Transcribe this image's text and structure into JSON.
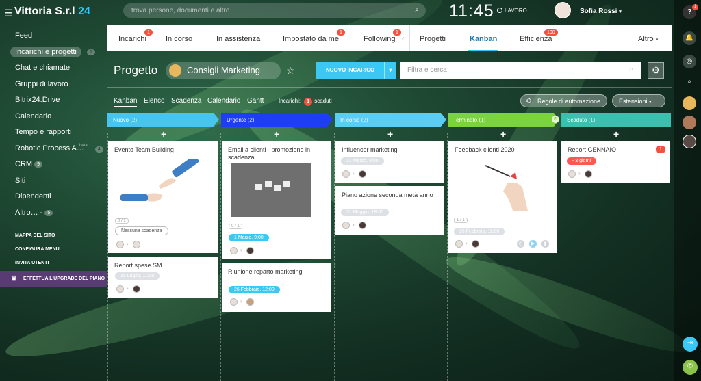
{
  "header": {
    "logo_name": "Vittoria S.r.l",
    "logo_num": "24",
    "search_placeholder": "trova persone, documenti e altro",
    "clock": "11:45",
    "work_status": "LAVORO",
    "user_name": "Sofia Rossi"
  },
  "sidebar": {
    "items": [
      {
        "label": "Feed",
        "badge": ""
      },
      {
        "label": "Incarichi e progetti",
        "badge": "1"
      },
      {
        "label": "Chat e chiamate",
        "badge": ""
      },
      {
        "label": "Gruppi di lavoro",
        "badge": ""
      },
      {
        "label": "Bitrix24.Drive",
        "badge": ""
      },
      {
        "label": "Calendario",
        "badge": ""
      },
      {
        "label": "Tempo e rapporti",
        "badge": ""
      },
      {
        "label": "Robotic Process A…",
        "badge": "4",
        "tag": "beta"
      },
      {
        "label": "CRM",
        "badge": "9"
      },
      {
        "label": "Siti",
        "badge": ""
      },
      {
        "label": "Dipendenti",
        "badge": ""
      },
      {
        "label": "Altro… -",
        "badge": "5"
      }
    ],
    "links": [
      "MAPPA DEL SITO",
      "CONFIGURA MENU",
      "INVITA UTENTI"
    ],
    "upgrade": "EFFETTUA L'UPGRADE DEL PIANO"
  },
  "tabs": [
    {
      "label": "Incarichi",
      "badge": "1"
    },
    {
      "label": "In corso",
      "badge": ""
    },
    {
      "label": "In assistenza",
      "badge": ""
    },
    {
      "label": "Impostato da me",
      "badge": "1"
    },
    {
      "label": "Following",
      "badge": "1"
    },
    {
      "label": "Progetti",
      "badge": ""
    },
    {
      "label": "Kanban",
      "badge": ""
    },
    {
      "label": "Efficienza",
      "badge": "100"
    },
    {
      "label": "Altro",
      "badge": ""
    }
  ],
  "project": {
    "label": "Progetto",
    "name": "Consigli Marketing",
    "new_button": "NUOVO INCARICO",
    "filter_placeholder": "Filtra e cerca"
  },
  "views": [
    "Kanban",
    "Elenco",
    "Scadenza",
    "Calendario",
    "Gantt"
  ],
  "overdue": {
    "prefix": "Incarichi:",
    "count": "1",
    "suffix": "scaduti"
  },
  "automation_button": "Regole di automazione",
  "extensions_button": "Estensioni",
  "columns": [
    {
      "name": "Nuovo",
      "count": "(2)",
      "color": "#47c5ef"
    },
    {
      "name": "Urgente",
      "count": "(2)",
      "color": "#1d3ef5"
    },
    {
      "name": "In corso",
      "count": "(2)",
      "color": "#5ccdf2"
    },
    {
      "name": "Terminato",
      "count": "(1)",
      "color": "#7bd43e"
    },
    {
      "name": "Scaduto",
      "count": "(1)",
      "color": "#3cbfae"
    }
  ],
  "cards": {
    "c1": {
      "title": "Evento Team Building",
      "checklist": "0 / 1",
      "deadline": "Nessuna scadenza"
    },
    "c2": {
      "title": "Report spese SM",
      "deadline": "15 Luglio, 11:00"
    },
    "c3": {
      "title": "Email a clienti - promozione in scadenza",
      "checklist": "0 / 1",
      "deadline": "1 Marzo, 9:00"
    },
    "c4": {
      "title": "Riunione reparto marketing",
      "deadline": "26 Febbraio, 12:00"
    },
    "c5": {
      "title": "Influencer marketing",
      "deadline": "31 Marzo, 9:00"
    },
    "c6": {
      "title": "Piano azione seconda metà anno",
      "deadline": "31 Maggio, 18:00"
    },
    "c7": {
      "title": "Feedback clienti 2020",
      "checklist": "1 / 1",
      "deadline": "26 Febbraio, 11:00"
    },
    "c8": {
      "title": "Report GENNAIO",
      "count": "1",
      "deadline": "- 3 giorni"
    }
  },
  "colors": {
    "accent": "#2fc6f6",
    "badge_red": "#f0523d",
    "upgrade_purple": "#6e3c8c"
  }
}
